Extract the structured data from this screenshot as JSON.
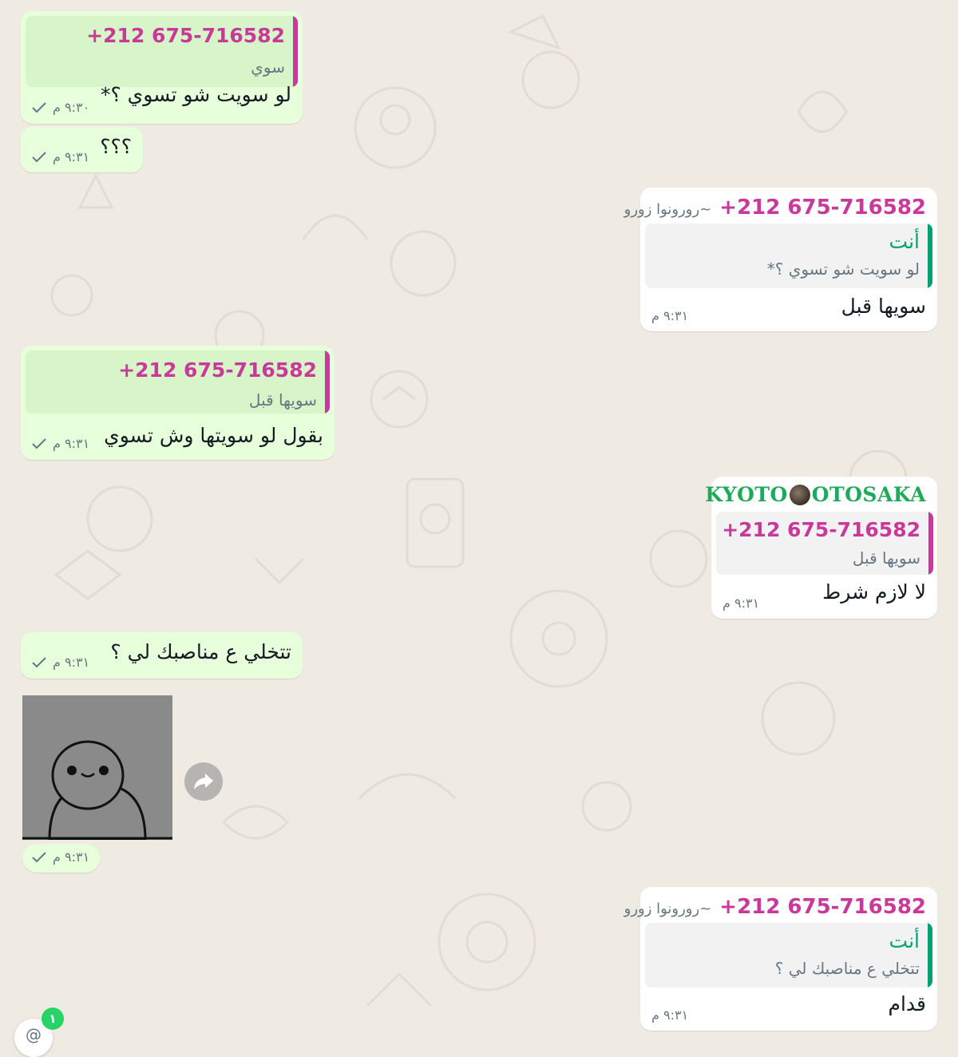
{
  "messages": [
    {
      "id": "m1",
      "direction": "outgoing",
      "quote": {
        "name": "+212 675-716582",
        "text": "سوي"
      },
      "text": "لو سويت شو تسوي ؟*",
      "time": "٩:٣٠ م",
      "status": "sent"
    },
    {
      "id": "m2",
      "direction": "outgoing",
      "text": "؟؟؟",
      "time": "٩:٣١ م",
      "status": "sent"
    },
    {
      "id": "m3",
      "direction": "incoming",
      "sender": {
        "number": "+212 675-716582",
        "alias": "~رورونوا زورو"
      },
      "quote": {
        "name": "أنت",
        "text": "لو سويت شو تسوي ؟*"
      },
      "text": "سويها قبل",
      "time": "٩:٣١ م"
    },
    {
      "id": "m4",
      "direction": "outgoing",
      "quote": {
        "name": "+212 675-716582",
        "text": "سويها قبل"
      },
      "text": "بقول لو سويتها وش تسوي",
      "time": "٩:٣١ م",
      "status": "sent"
    },
    {
      "id": "m5",
      "direction": "incoming",
      "sender": {
        "name_left": "KYOTO",
        "name_right": "OTOSAKA"
      },
      "quote": {
        "name": "+212 675-716582",
        "text": "سويها قبل"
      },
      "text": "لا لازم شرط",
      "time": "٩:٣١ م"
    },
    {
      "id": "m6",
      "direction": "outgoing",
      "text": "تتخلي ع مناصبك لي ؟",
      "time": "٩:٣١ م",
      "status": "sent"
    },
    {
      "id": "m7",
      "direction": "outgoing",
      "type": "image",
      "time": "٩:٣١ م",
      "status": "sent"
    },
    {
      "id": "m8",
      "direction": "incoming",
      "sender": {
        "number": "+212 675-716582",
        "alias": "~رورونوا زورو"
      },
      "quote": {
        "name": "أنت",
        "text": "تتخلي ع مناصبك لي ؟"
      },
      "text": "قدام",
      "time": "٩:٣١ م"
    }
  ],
  "mention_badge": {
    "count": "١",
    "icon": "@"
  },
  "colors": {
    "outgoing_bg": "#e7ffdb",
    "incoming_bg": "#ffffff",
    "sender_pink": "#c8399a",
    "you_teal": "#07a074",
    "wallpaper": "#efeae2"
  },
  "icons": {
    "tick": "check-icon",
    "forward": "forward-icon",
    "mention": "at-icon"
  }
}
